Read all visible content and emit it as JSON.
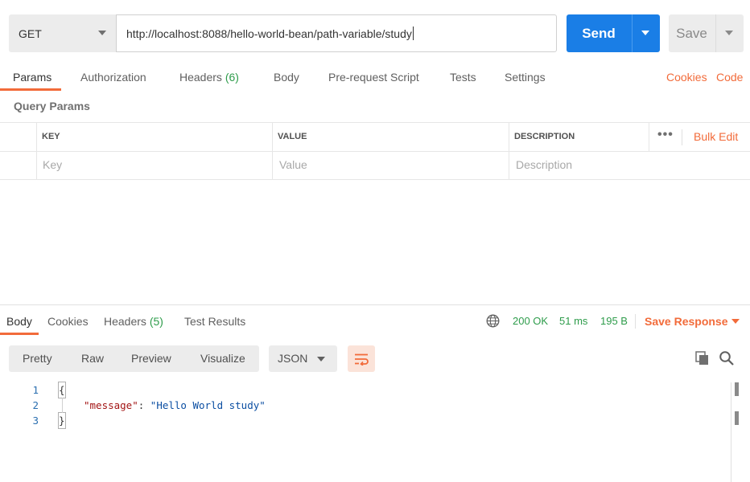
{
  "request": {
    "method": "GET",
    "url": "http://localhost:8088/hello-world-bean/path-variable/study",
    "send_label": "Send",
    "save_label": "Save"
  },
  "request_tabs": {
    "params": "Params",
    "authorization": "Authorization",
    "headers": "Headers",
    "headers_count": "(6)",
    "body": "Body",
    "prerequest": "Pre-request Script",
    "tests": "Tests",
    "settings": "Settings",
    "cookies": "Cookies",
    "code": "Code"
  },
  "query_params": {
    "title": "Query Params",
    "columns": {
      "key": "KEY",
      "value": "VALUE",
      "description": "DESCRIPTION"
    },
    "more": "•••",
    "bulk_edit": "Bulk Edit",
    "placeholders": {
      "key": "Key",
      "value": "Value",
      "description": "Description"
    }
  },
  "response_tabs": {
    "body": "Body",
    "cookies": "Cookies",
    "headers": "Headers",
    "headers_count": "(5)",
    "test_results": "Test Results"
  },
  "response_status": {
    "status": "200 OK",
    "time": "51 ms",
    "size": "195 B",
    "save_response": "Save Response"
  },
  "view_modes": {
    "pretty": "Pretty",
    "raw": "Raw",
    "preview": "Preview",
    "visualize": "Visualize",
    "format": "JSON"
  },
  "code_lines": [
    {
      "num": "1",
      "text": "{"
    },
    {
      "num": "2",
      "key": "\"message\"",
      "sep": ": ",
      "value": "\"Hello World study\""
    },
    {
      "num": "3",
      "text": "}"
    }
  ],
  "colors": {
    "accent": "#f26b3a",
    "send": "#1a7ee6",
    "success": "#2e9c4b"
  }
}
